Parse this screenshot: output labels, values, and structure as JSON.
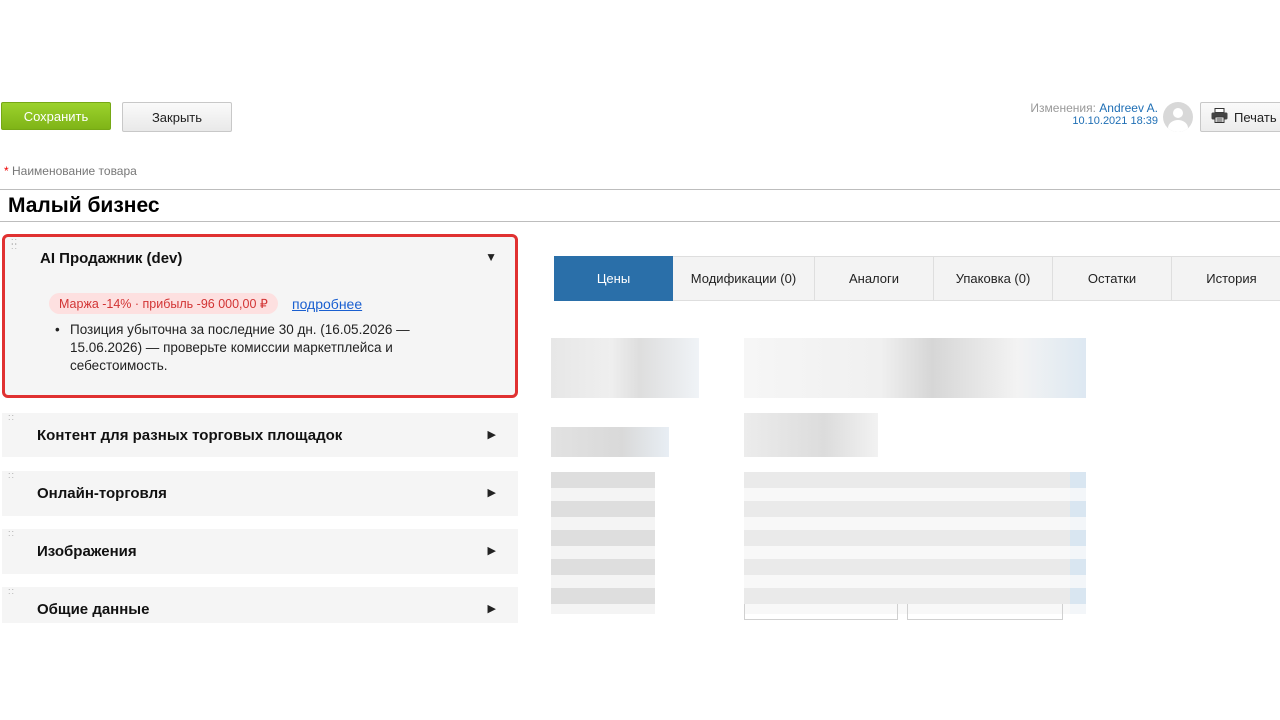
{
  "toolbar": {
    "save_label": "Сохранить",
    "close_label": "Закрыть",
    "changes_label": "Изменения:",
    "changes_user": "Andreev A.",
    "changes_date": "10.10.2021 18:39",
    "print_label": "Печать"
  },
  "product": {
    "required_label": "Наименование товара",
    "required_star": "*",
    "name": "Малый бизнес"
  },
  "ai_panel": {
    "title": "AI Продажник (dev)",
    "pill": "Маржа -14% · прибыль -96 000,00 ₽",
    "more_link": "подробнее",
    "bullet": "Позиция убыточна за последние 30 дн. (16.05.2026 — 15.06.2026) — проверьте комиссии маркетплейса и себестоимость."
  },
  "sections": [
    {
      "title": "Контент для разных торговых площадок"
    },
    {
      "title": "Онлайн-торговля"
    },
    {
      "title": "Изображения"
    },
    {
      "title": "Общие данные"
    }
  ],
  "tabs": [
    {
      "label": "Цены"
    },
    {
      "label": "Модификации (0)"
    },
    {
      "label": "Аналоги"
    },
    {
      "label": "Упаковка (0)"
    },
    {
      "label": "Остатки"
    },
    {
      "label": "История"
    }
  ],
  "colors": {
    "save_button": "#8cc51f",
    "active_tab": "#2a6fa9",
    "ai_border": "#e03131",
    "link": "#1a5fd0"
  }
}
